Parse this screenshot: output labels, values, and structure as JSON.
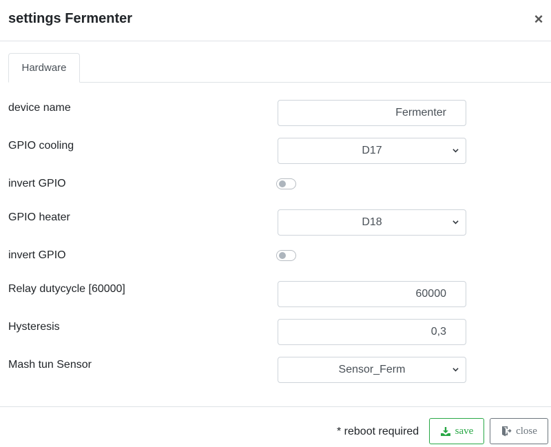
{
  "modal": {
    "title": "settings Fermenter",
    "close_glyph": "×"
  },
  "tabs": [
    {
      "label": "Hardware",
      "active": true
    }
  ],
  "fields": {
    "device_name": {
      "label": "device name",
      "value": "Fermenter"
    },
    "gpio_cooling": {
      "label": "GPIO cooling",
      "value": "D17"
    },
    "invert_cooling": {
      "label": "invert GPIO",
      "checked": false
    },
    "gpio_heater": {
      "label": "GPIO heater",
      "value": "D18"
    },
    "invert_heater": {
      "label": "invert GPIO",
      "checked": false
    },
    "relay_dutycycle": {
      "label": "Relay dutycycle [60000]",
      "value": "60000"
    },
    "hysteresis": {
      "label": "Hysteresis",
      "value": "0,3"
    },
    "mash_tun_sensor": {
      "label": "Mash tun Sensor",
      "value": "Sensor_Ferm"
    }
  },
  "footer": {
    "reboot_note": "* reboot required",
    "save_label": "save",
    "close_label": "close"
  },
  "icons": {
    "save": "download-icon",
    "close": "exit-door-icon",
    "select": "chevron-down-icon"
  },
  "colors": {
    "save_accent": "#28a745",
    "close_accent": "#6c757d",
    "border": "#ced4da"
  }
}
